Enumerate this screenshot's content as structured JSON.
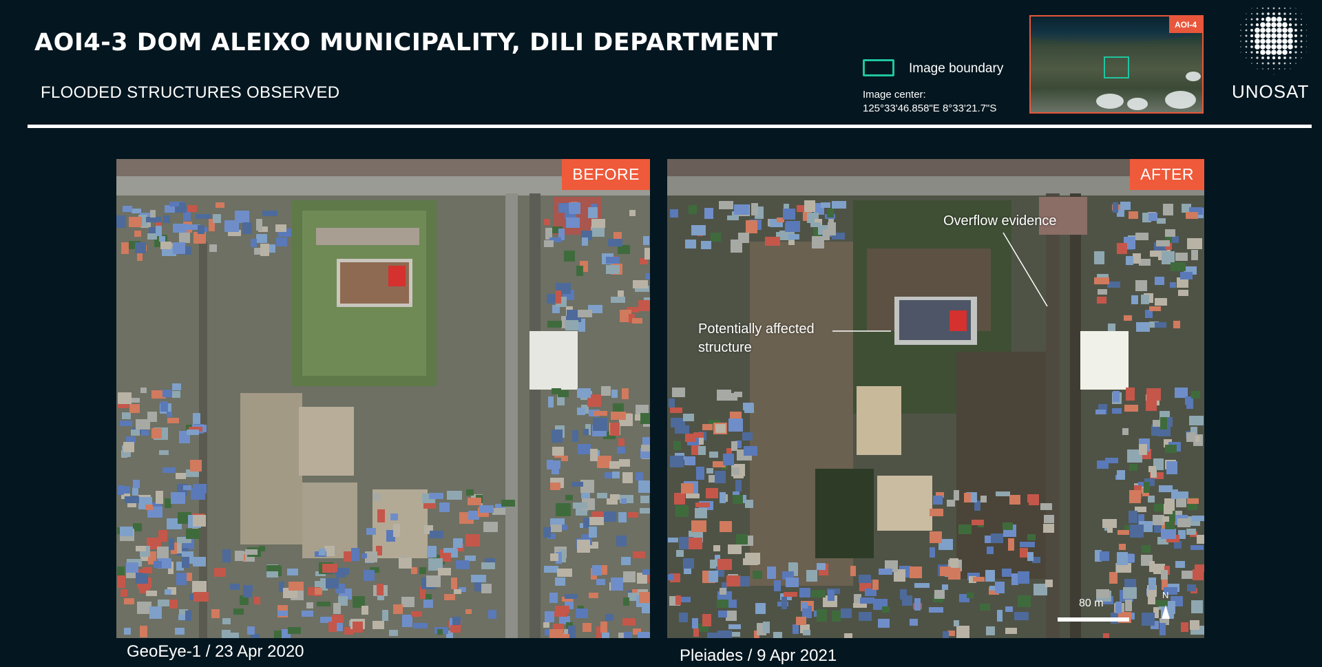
{
  "header": {
    "title": "AOI4-3 DOM ALEIXO MUNICIPALITY, DILI DEPARTMENT",
    "subtitle": "FLOODED STRUCTURES OBSERVED"
  },
  "legend": {
    "boundary_label": "Image boundary",
    "center_label": "Image center:",
    "center_value": "125°33'46.858\"E  8°33'21.7\"S",
    "boundary_color": "#1fc5a0"
  },
  "overview": {
    "tag": "AOI-4"
  },
  "logo": {
    "text": "UNOSAT"
  },
  "before": {
    "tag": "BEFORE",
    "caption": "GeoEye-1 / 23 Apr 2020"
  },
  "after": {
    "tag": "AFTER",
    "caption": "Pleiades / 9 Apr 2021",
    "annotation_overflow": "Overflow evidence",
    "annotation_structure_line1": "Potentially affected",
    "annotation_structure_line2": "structure",
    "scale_label": "80 m",
    "north_label": "N"
  },
  "colors": {
    "background": "#04161f",
    "accent": "#ef5a3a",
    "boundary": "#1fc5a0"
  }
}
